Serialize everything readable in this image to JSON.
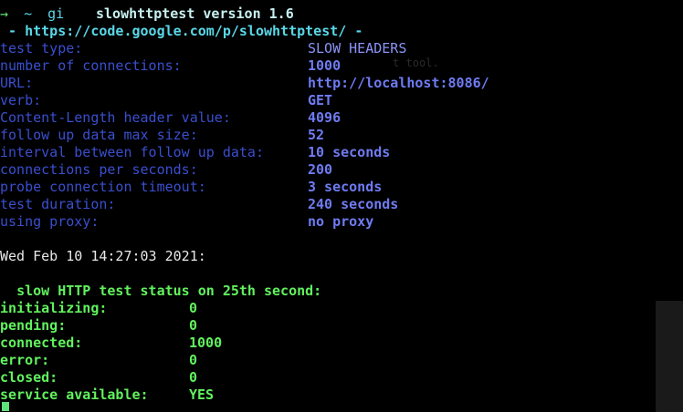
{
  "prompt": {
    "arrow": "→",
    "tilde": "~",
    "partial": "gi"
  },
  "header": {
    "title": "slowhttptest version 1.6",
    "url_line": " - https://code.google.com/p/slowhttptest/ -"
  },
  "config": [
    {
      "label": "test type:",
      "value": "SLOW HEADERS"
    },
    {
      "label": "number of connections:",
      "value": "1000"
    },
    {
      "label": "URL:",
      "value": "http://localhost:8086/"
    },
    {
      "label": "verb:",
      "value": "GET"
    },
    {
      "label": "Content-Length header value:",
      "value": "4096"
    },
    {
      "label": "follow up data max size:",
      "value": "52"
    },
    {
      "label": "interval between follow up data:",
      "value": "10 seconds"
    },
    {
      "label": "connections per seconds:",
      "value": "200"
    },
    {
      "label": "probe connection timeout:",
      "value": "3 seconds"
    },
    {
      "label": "test duration:",
      "value": "240 seconds"
    },
    {
      "label": "using proxy:",
      "value": "no proxy"
    }
  ],
  "status": {
    "timestamp": "Wed Feb 10 14:27:03 2021:",
    "heading_prefix": "slow HTTP test status on ",
    "second": "25",
    "heading_suffix": "th second:",
    "rows": [
      {
        "label": "initializing:",
        "value": "0"
      },
      {
        "label": "pending:",
        "value": "0"
      },
      {
        "label": "connected:",
        "value": "1000"
      },
      {
        "label": "error:",
        "value": "0"
      },
      {
        "label": "closed:",
        "value": "0"
      },
      {
        "label": "service available:",
        "value": "YES"
      }
    ]
  }
}
